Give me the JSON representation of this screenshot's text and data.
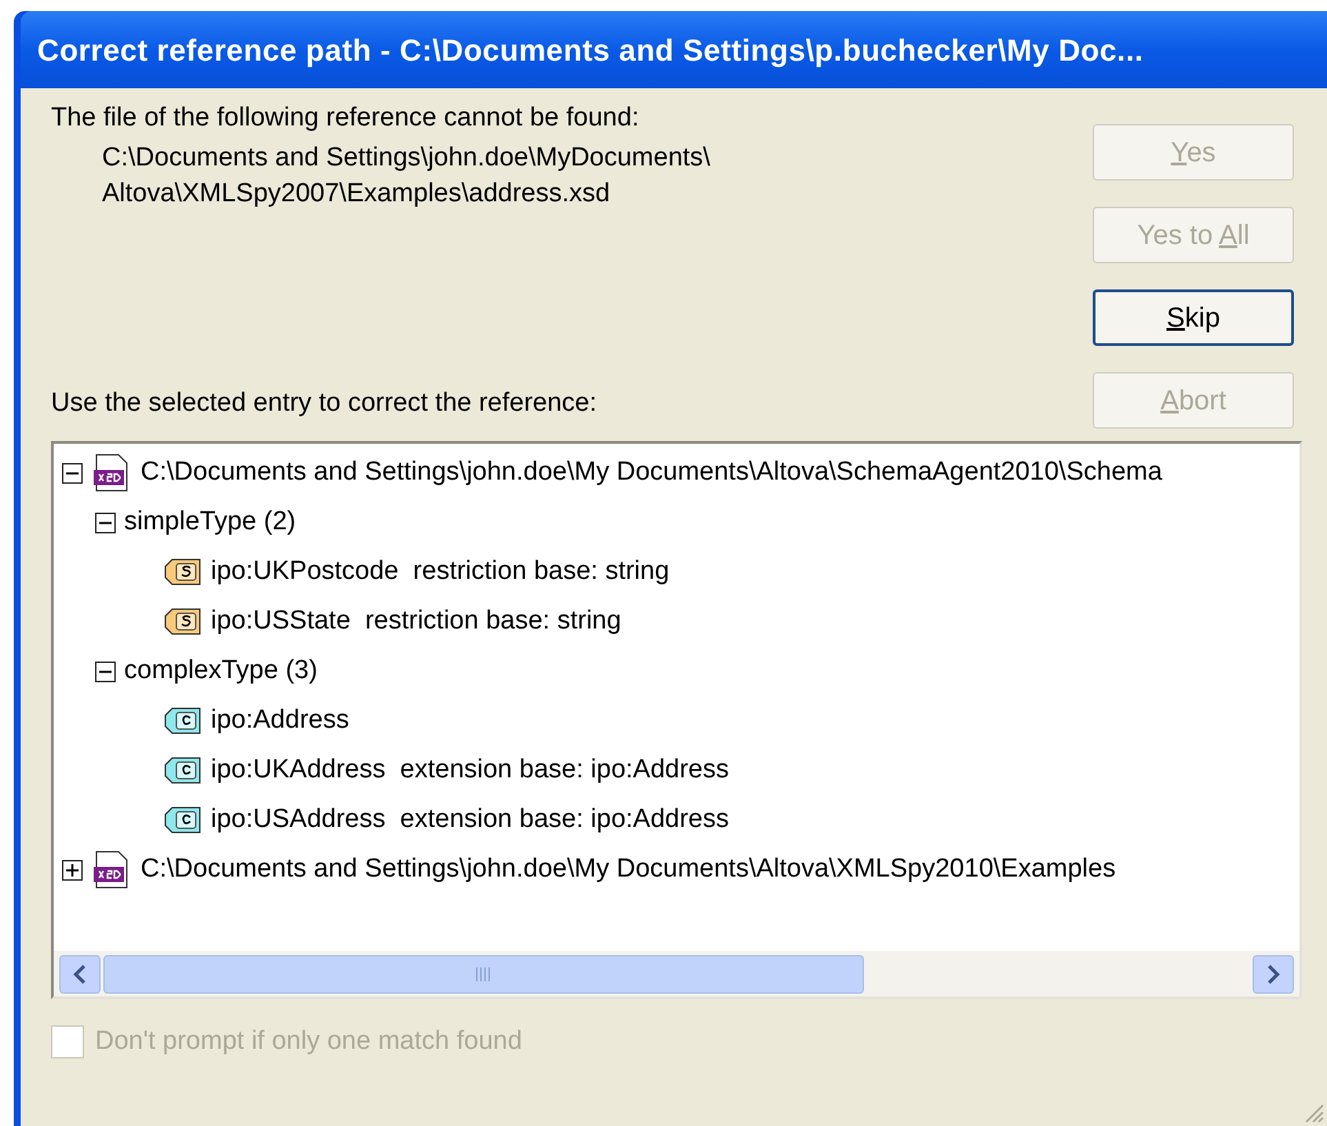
{
  "window": {
    "title": "Correct reference path - C:\\Documents and Settings\\p.buchecker\\My Doc..."
  },
  "message": {
    "text": "The file of the following reference cannot be found:",
    "path_lines": [
      "C:\\Documents and Settings\\john.doe\\MyDocuments\\",
      "Altova\\XMLSpy2007\\Examples\\address.xsd"
    ]
  },
  "buttons": [
    {
      "key": "Y",
      "after": "es",
      "disabled": true,
      "focused": false
    },
    {
      "before": "Yes to ",
      "key": "A",
      "after": "ll",
      "disabled": true,
      "focused": false
    },
    {
      "key": "S",
      "after": "kip",
      "disabled": false,
      "focused": true
    },
    {
      "key": "A",
      "after": "bort",
      "disabled": true,
      "focused": false
    }
  ],
  "tree_label": "Use the selected entry to correct the reference:",
  "tree": [
    {
      "kind": "xsd",
      "label": "C:\\Documents and Settings\\john.doe\\My Documents\\Altova\\SchemaAgent2010\\Schema",
      "expanded": true,
      "children": [
        {
          "kind": "group",
          "label": "simpleType (2)",
          "expanded": true,
          "children": [
            {
              "kind": "simple",
              "label": "ipo:UKPostcode  restriction base: string"
            },
            {
              "kind": "simple",
              "label": "ipo:USState  restriction base: string"
            }
          ]
        },
        {
          "kind": "group",
          "label": "complexType (3)",
          "expanded": true,
          "children": [
            {
              "kind": "complex",
              "label": "ipo:Address"
            },
            {
              "kind": "complex",
              "label": "ipo:UKAddress  extension base: ipo:Address"
            },
            {
              "kind": "complex",
              "label": "ipo:USAddress  extension base: ipo:Address"
            }
          ]
        }
      ]
    },
    {
      "kind": "xsd",
      "label": "C:\\Documents and Settings\\john.doe\\My Documents\\Altova\\XMLSpy2010\\Examples",
      "expanded": false
    }
  ],
  "checkbox": {
    "label": "Don't prompt if only one match found",
    "checked": false,
    "disabled": true
  }
}
